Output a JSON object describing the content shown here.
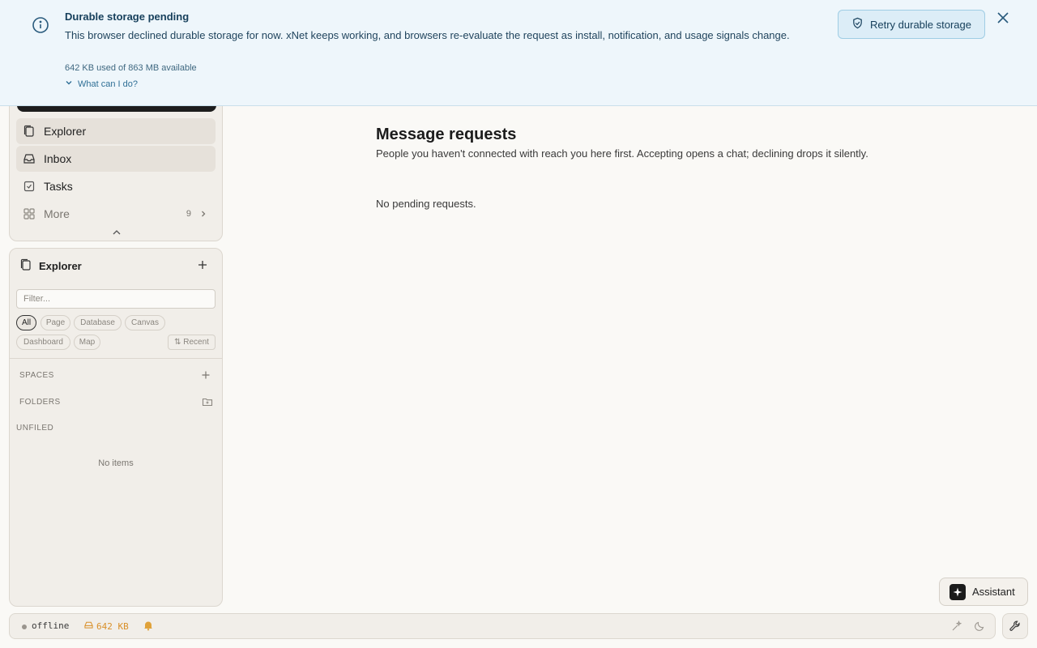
{
  "banner": {
    "title": "Durable storage pending",
    "body": "This browser declined durable storage for now. xNet keeps working, and browsers re-evaluate the request as install, notification, and usage signals change.",
    "usage": "642 KB used of 863 MB available",
    "help_link": "What can I do?",
    "retry_label": "Retry durable storage",
    "icon": "info-icon",
    "accent": "#17405c"
  },
  "nav": {
    "items": [
      {
        "label": "Explorer",
        "icon": "pages-icon",
        "active": true
      },
      {
        "label": "Inbox",
        "icon": "inbox-icon",
        "active": true
      },
      {
        "label": "Tasks",
        "icon": "checkbox-icon",
        "active": false
      },
      {
        "label": "More",
        "icon": "grid-icon",
        "count": "9"
      }
    ]
  },
  "explorer": {
    "title": "Explorer",
    "filter_placeholder": "Filter...",
    "chips": [
      "All",
      "Page",
      "Database",
      "Canvas",
      "Dashboard",
      "Map"
    ],
    "active_chip": "All",
    "sort_label": "⇅ Recent",
    "sections": {
      "spaces": "SPACES",
      "folders": "FOLDERS",
      "unfiled": "UNFILED"
    },
    "empty_text": "No items"
  },
  "main": {
    "title": "Message requests",
    "description": "People you haven't connected with reach you here first. Accepting opens a chat; declining drops it silently.",
    "empty_text": "No pending requests."
  },
  "assistant": {
    "label": "Assistant"
  },
  "statusbar": {
    "connection": "offline",
    "storage": "642 KB",
    "storage_color": "#d9902a"
  }
}
